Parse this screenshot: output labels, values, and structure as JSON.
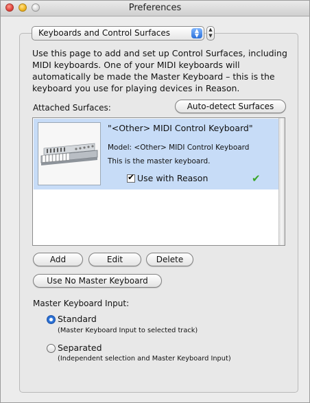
{
  "window": {
    "title": "Preferences"
  },
  "section_popup": {
    "value": "Keyboards and Control Surfaces"
  },
  "description": "Use this page to add and set up Control Surfaces, including MIDI keyboards. One of your MIDI keyboards will automatically be made the Master Keyboard – this is the keyboard you use for playing devices in Reason.",
  "attached": {
    "label": "Attached Surfaces:",
    "auto_detect_label": "Auto-detect Surfaces",
    "items": [
      {
        "name": "\"<Other> MIDI Control Keyboard\"",
        "model": "Model: <Other> MIDI Control Keyboard",
        "status": "This is the master keyboard.",
        "use_with_reason_label": "Use with Reason",
        "use_with_reason_checked": true,
        "thumbnail_icon": "midi-keyboard-icon"
      }
    ]
  },
  "buttons": {
    "add": "Add",
    "edit": "Edit",
    "delete": "Delete",
    "use_no_master": "Use No Master Keyboard"
  },
  "master_input": {
    "label": "Master Keyboard Input:",
    "options": [
      {
        "label": "Standard",
        "hint": "(Master Keyboard Input to selected track)",
        "selected": true
      },
      {
        "label": "Separated",
        "hint": "(Independent selection and Master Keyboard Input)",
        "selected": false
      }
    ]
  },
  "colors": {
    "selection": "#c7dcf7",
    "accent": "#2f76da",
    "ok_check": "#3aa629"
  }
}
